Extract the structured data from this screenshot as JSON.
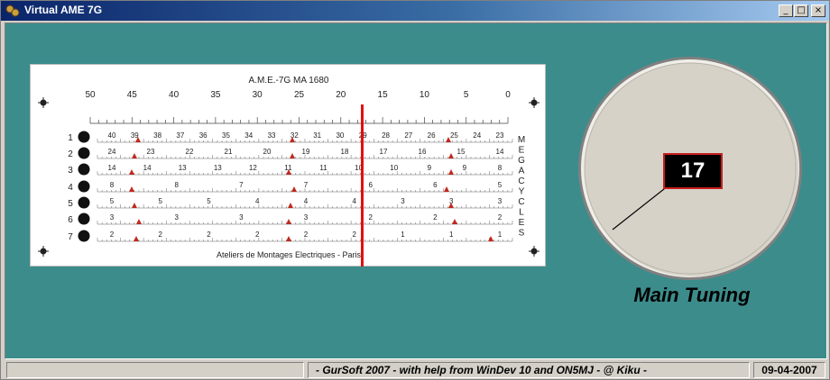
{
  "window": {
    "title": "Virtual AME 7G",
    "minimize_glyph": "_",
    "maximize_glyph": "□",
    "close_glyph": "×"
  },
  "dial": {
    "title": "A.M.E.-7G MA 1680",
    "footer": "Ateliers de Montages Electriques - Paris",
    "top_scale": [
      "50",
      "45",
      "40",
      "35",
      "30",
      "25",
      "20",
      "15",
      "10",
      "5",
      "0"
    ],
    "band_numbers": [
      "1",
      "2",
      "3",
      "4",
      "5",
      "6",
      "7"
    ],
    "side_letters": [
      "M",
      "E",
      "G",
      "A",
      "C",
      "Y",
      "C",
      "L",
      "E",
      "S"
    ],
    "band_labels": [
      [
        "40",
        "39",
        "38",
        "37",
        "36",
        "35",
        "34",
        "33",
        "32",
        "31",
        "30",
        "29",
        "28",
        "27",
        "26",
        "25",
        "24",
        "23"
      ],
      [
        "24",
        "23",
        "22",
        "21",
        "20",
        "19",
        "18",
        "17",
        "16",
        "15",
        "14"
      ],
      [
        "14",
        "14",
        "13",
        "13",
        "12",
        "11",
        "11",
        "10",
        "10",
        "9",
        "9",
        "8"
      ],
      [
        "8",
        "8",
        "7",
        "7",
        "6",
        "6",
        "5"
      ],
      [
        "5",
        "5",
        "5",
        "4",
        "4",
        "4",
        "3",
        "3",
        "3"
      ],
      [
        "3",
        "3",
        "3",
        "3",
        "2",
        "2",
        "2"
      ],
      [
        "2",
        "2",
        "2",
        "2",
        "2",
        "2",
        "1",
        "1",
        "1"
      ]
    ],
    "pointer_value": 18.5,
    "accent_color": "#e01010"
  },
  "tuning": {
    "readout": "17",
    "label": "Main Tuning",
    "knob_angle_deg": 235
  },
  "status": {
    "pane1": "",
    "pane2": "-   GurSoft 2007   -   with help from WinDev 10   and   ON5MJ   -   @ Kiku   -",
    "pane3": "09-04-2007"
  }
}
